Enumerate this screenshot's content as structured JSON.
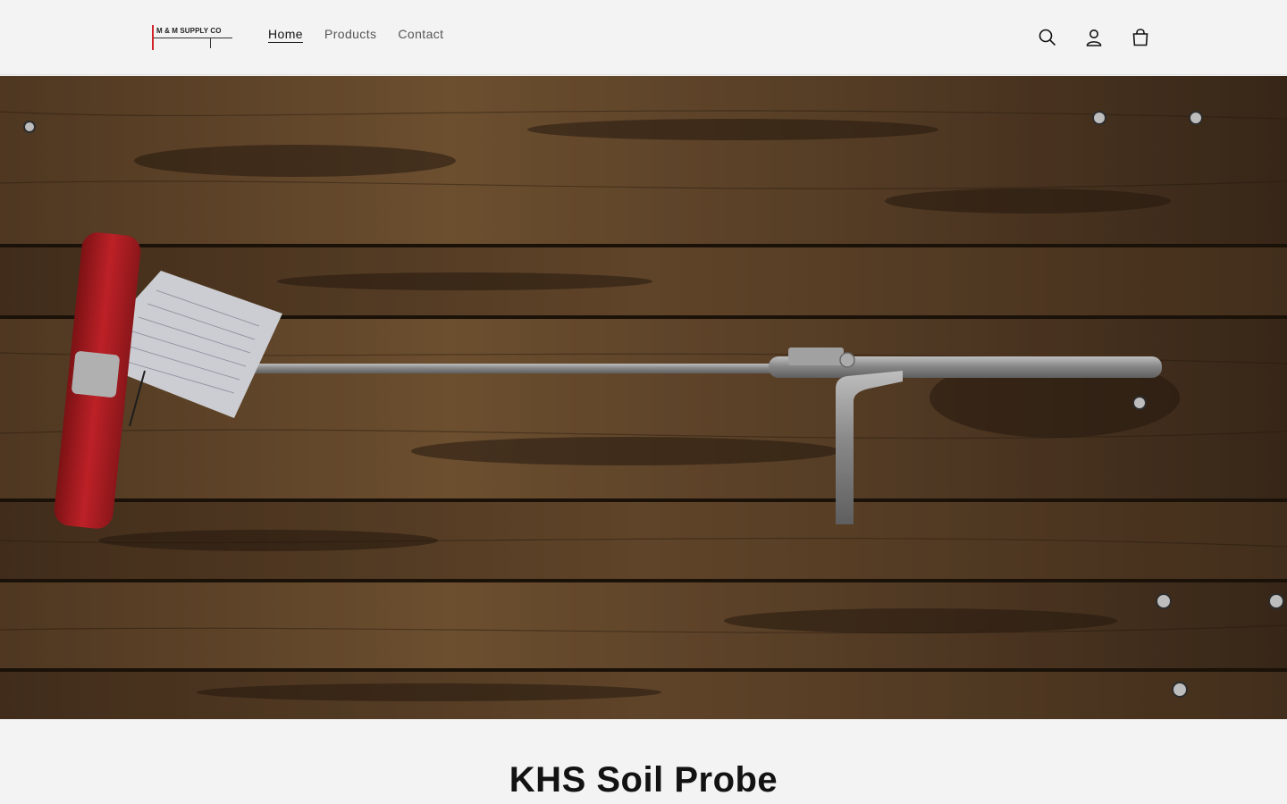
{
  "brand": {
    "logo_text": "M & M SUPPLY CO",
    "accent": "#d2232a"
  },
  "nav": {
    "items": [
      {
        "label": "Home",
        "active": true
      },
      {
        "label": "Products",
        "active": false
      },
      {
        "label": "Contact",
        "active": false
      }
    ]
  },
  "header_icons": [
    "search-icon",
    "account-icon",
    "cart-icon"
  ],
  "hero": {
    "image": "soil-probe-on-wood"
  },
  "product": {
    "title": "KHS Soil Probe"
  }
}
